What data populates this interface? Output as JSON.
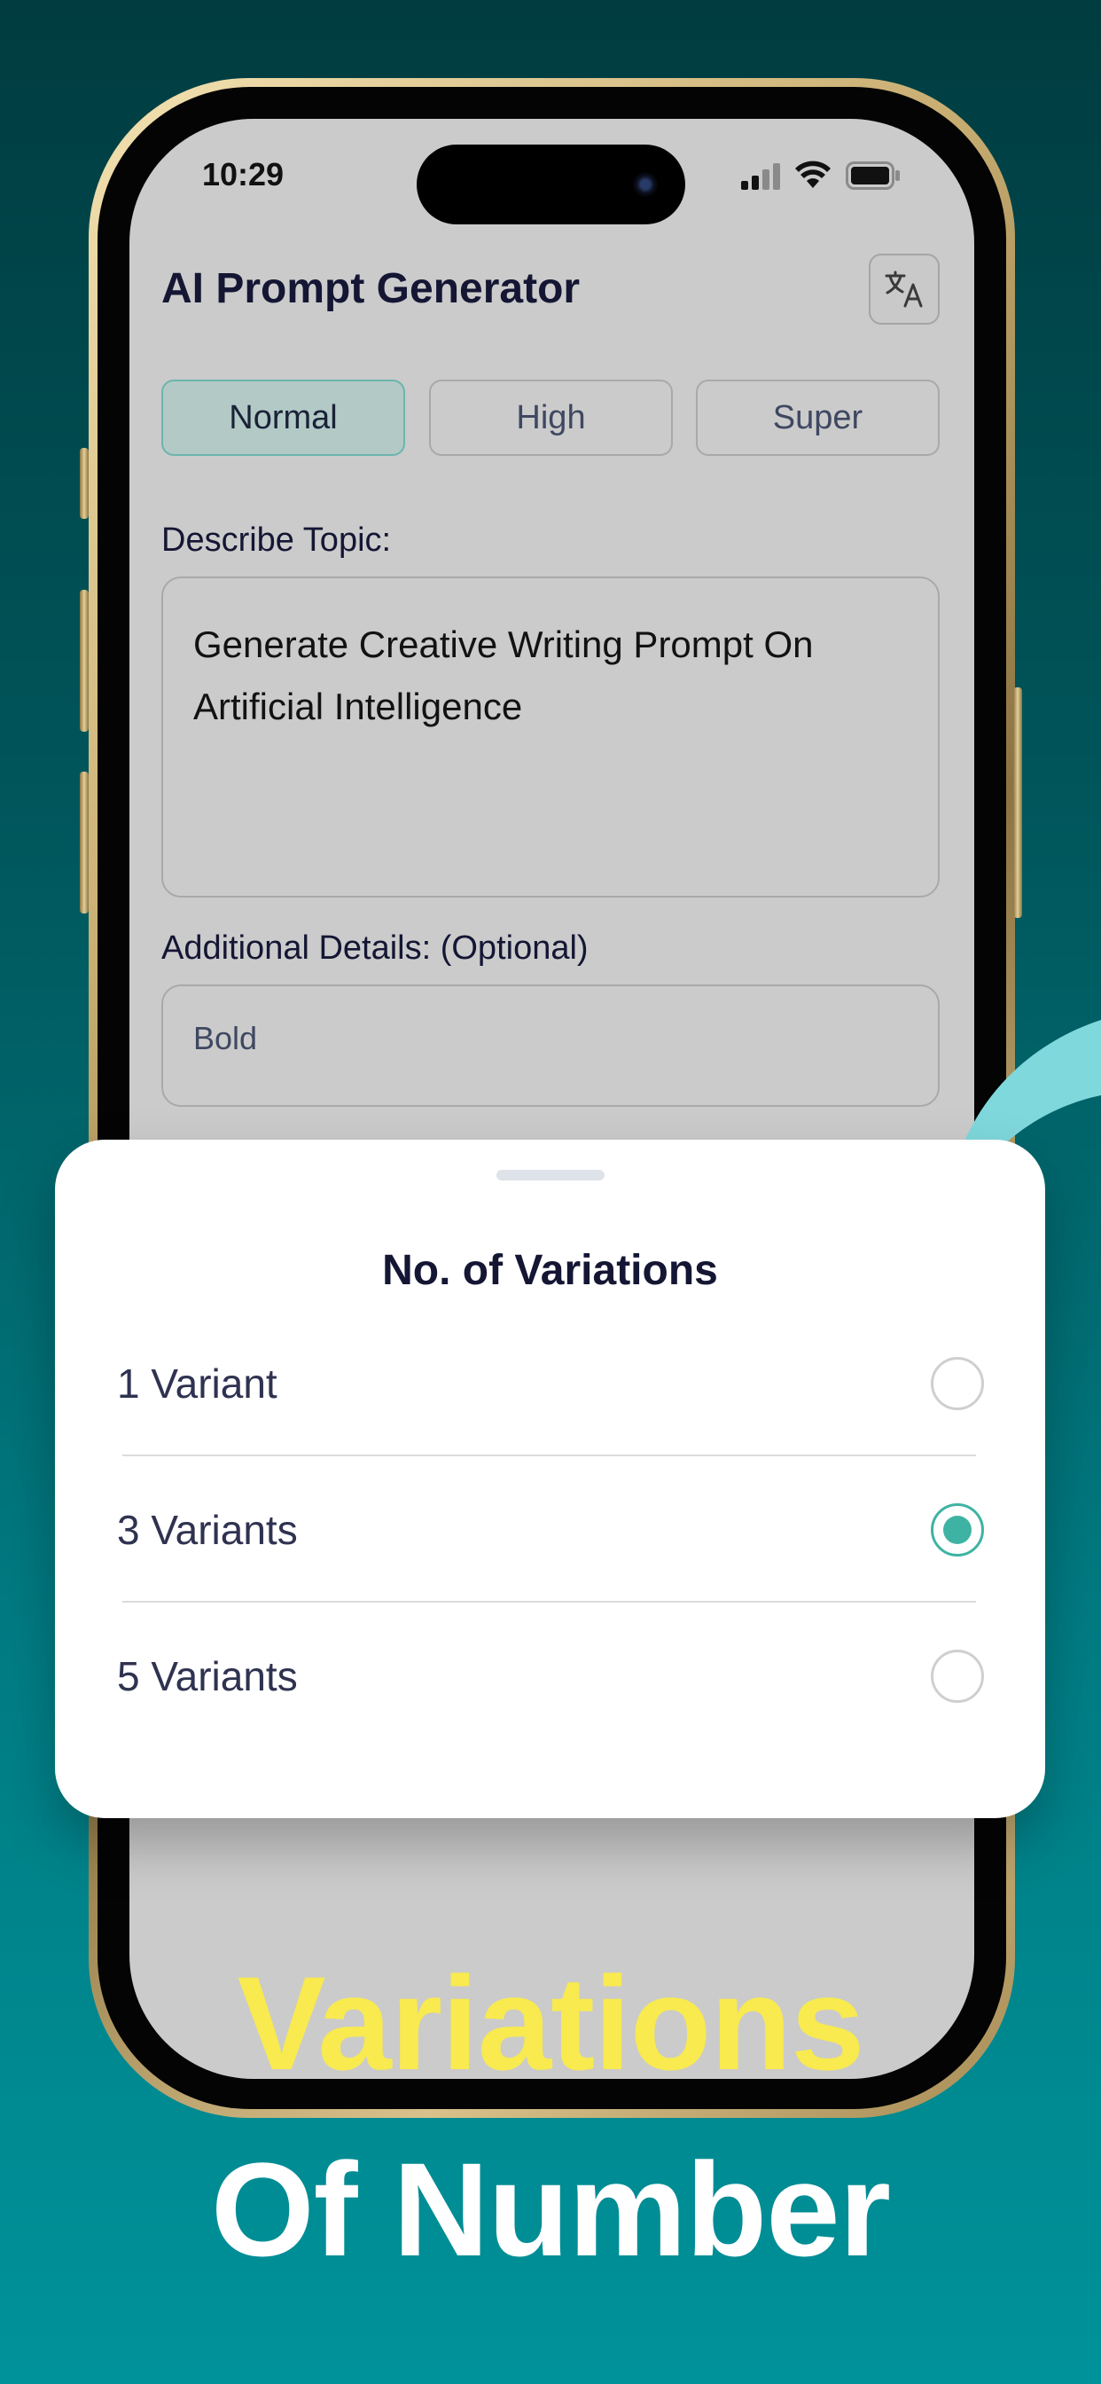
{
  "status_bar": {
    "time": "10:29"
  },
  "app": {
    "title": "AI Prompt Generator",
    "translate_icon": "translate-icon"
  },
  "quality_options": [
    {
      "label": "Normal",
      "selected": true
    },
    {
      "label": "High",
      "selected": false
    },
    {
      "label": "Super",
      "selected": false
    }
  ],
  "topic": {
    "label": "Describe Topic:",
    "value": "Generate Creative Writing Prompt On Artificial Intelligence"
  },
  "details": {
    "label": "Additional Details: (Optional)",
    "value": "Bold"
  },
  "sheet": {
    "title": "No. of Variations",
    "options": [
      {
        "label": "1 Variant",
        "selected": false
      },
      {
        "label": "3 Variants",
        "selected": true
      },
      {
        "label": "5 Variants",
        "selected": false
      }
    ]
  },
  "headline": {
    "line1": "Variations",
    "line2": "Of Number"
  },
  "colors": {
    "accent": "#3fb3a3",
    "headline_yellow": "#f8ea4f",
    "background_top": "#003c40",
    "background_bottom": "#00929a"
  }
}
